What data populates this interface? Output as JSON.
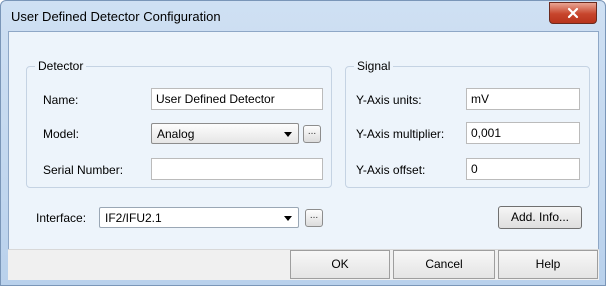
{
  "window": {
    "title": "User Defined Detector Configuration",
    "close_icon": "close-x"
  },
  "detector": {
    "group_title": "Detector",
    "name_label": "Name:",
    "name_value": "User Defined Detector",
    "model_label": "Model:",
    "model_value": "Analog",
    "model_browse": "...",
    "serial_label": "Serial Number:",
    "serial_value": ""
  },
  "signal": {
    "group_title": "Signal",
    "yunits_label": "Y-Axis units:",
    "yunits_value": "mV",
    "ymult_label": "Y-Axis multiplier:",
    "ymult_value": "0,001",
    "yoffset_label": "Y-Axis offset:",
    "yoffset_value": "0"
  },
  "interface": {
    "label": "Interface:",
    "value": "IF2/IFU2.1",
    "browse": "..."
  },
  "buttons": {
    "add_info": "Add. Info...",
    "ok": "OK",
    "cancel": "Cancel",
    "help": "Help"
  }
}
